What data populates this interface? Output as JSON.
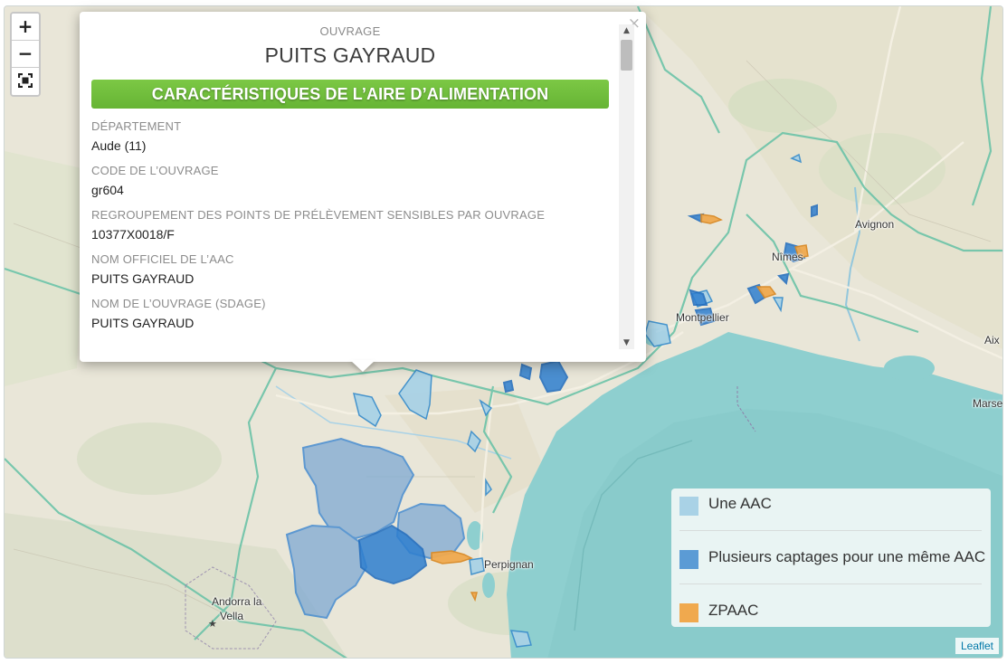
{
  "map": {
    "zoom_in_label": "+",
    "zoom_out_label": "−",
    "fullscreen_label": "⛶",
    "places": {
      "avignon": "Avignon",
      "nimes": "Nîmes",
      "montpellier": "Montpellier",
      "aix": "Aix",
      "marseille": "Marse",
      "perpignan": "Perpignan",
      "andorra_1": "Andorra la",
      "andorra_2": "Vella"
    },
    "attribution": "Leaflet"
  },
  "popup": {
    "close_label": "×",
    "eyebrow": "OUVRAGE",
    "title": "PUITS GAYRAUD",
    "section": "CARACTÉRISTIQUES DE L’AIRE D’ALIMENTATION",
    "fields": [
      {
        "label": "DÉPARTEMENT",
        "value": "Aude (11)"
      },
      {
        "label": "CODE DE L’OUVRAGE",
        "value": "gr604"
      },
      {
        "label": "REGROUPEMENT DES POINTS DE PRÉLÈVEMENT SENSIBLES PAR OUVRAGE",
        "value": "10377X0018/F"
      },
      {
        "label": "NOM OFFICIEL DE L’AAC",
        "value": "PUITS GAYRAUD"
      },
      {
        "label": "NOM DE L’OUVRAGE (SDAGE)",
        "value": "PUITS GAYRAUD"
      }
    ]
  },
  "legend": {
    "items": [
      {
        "label": "Une AAC",
        "color": "#a9d2e6"
      },
      {
        "label": "Plusieurs captages pour une même AAC",
        "color": "#5b9bd5"
      },
      {
        "label": "ZPAAC",
        "color": "#f0a94e"
      }
    ]
  },
  "colors": {
    "land": "#e8e4d6",
    "sea": "#8ecfcf",
    "region_border": "#6cc3a8",
    "aac": "#a9d2e6",
    "multi_aac": "#2f7fcf",
    "zpaac": "#f0a94e",
    "banner": "#66b434"
  }
}
